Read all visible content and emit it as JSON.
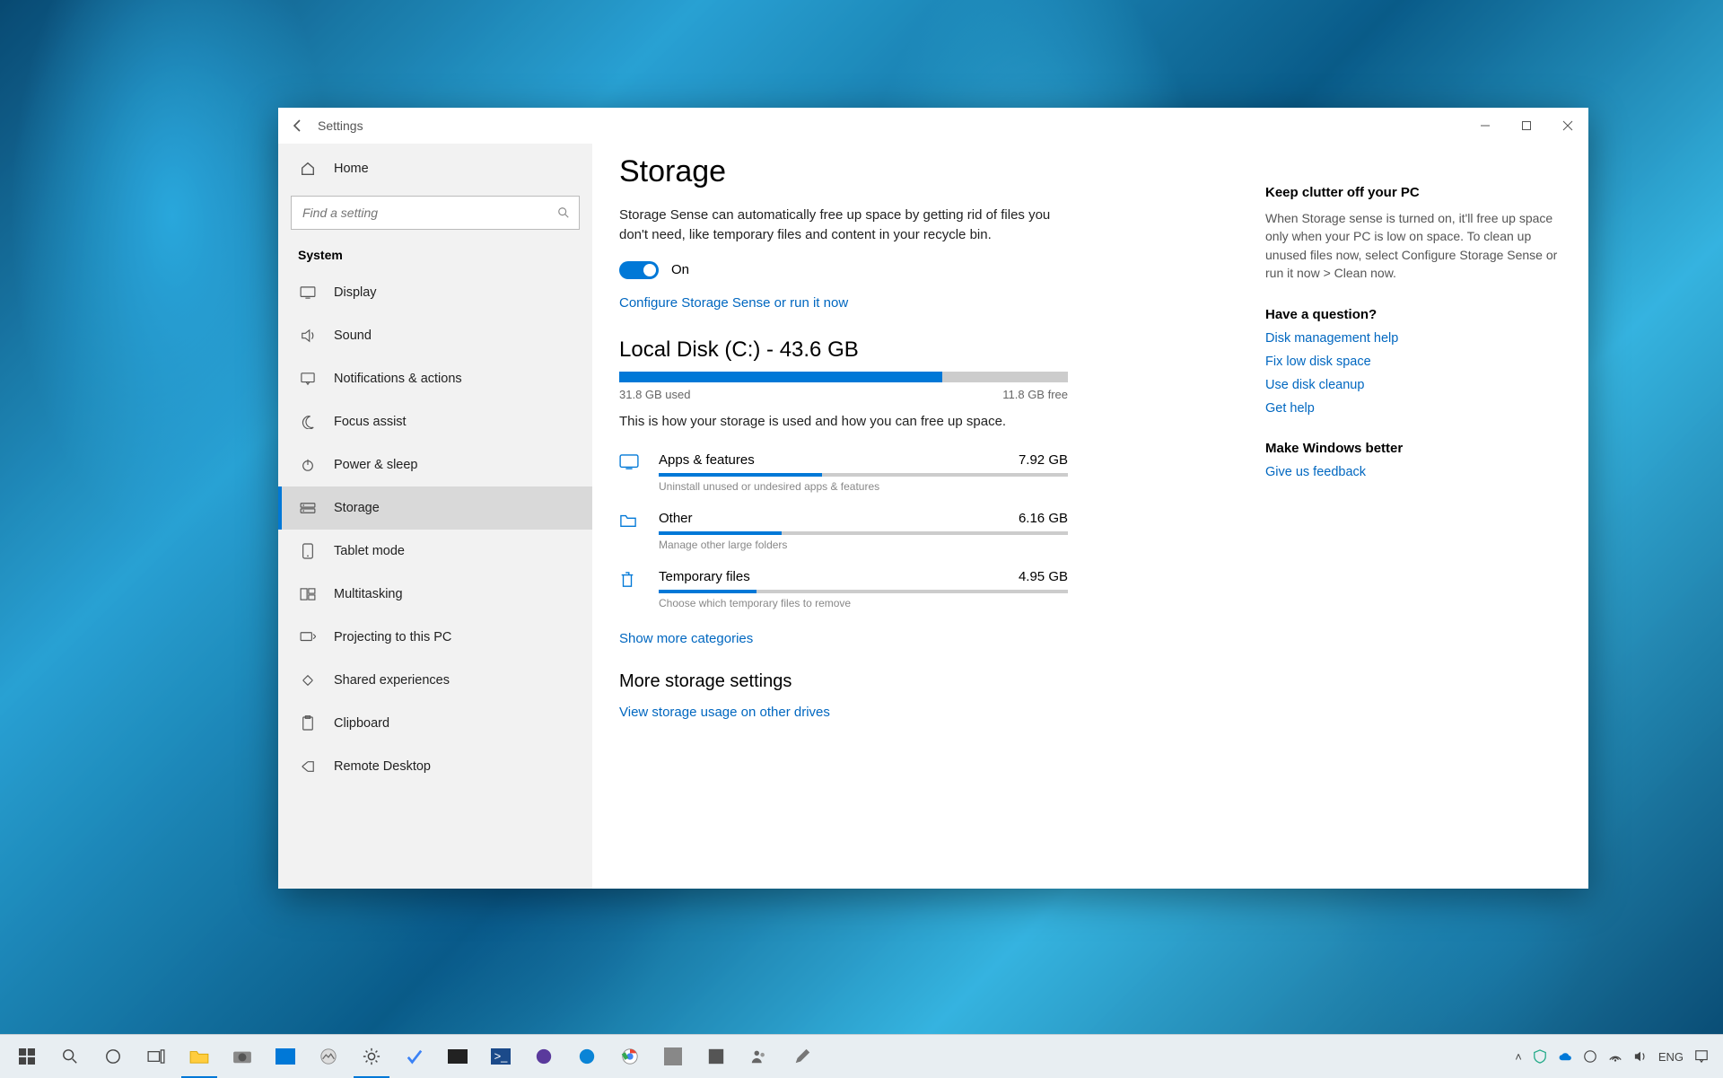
{
  "window": {
    "title": "Settings"
  },
  "sidebar": {
    "home": "Home",
    "search_placeholder": "Find a setting",
    "category": "System",
    "items": [
      {
        "label": "Display",
        "icon": "display"
      },
      {
        "label": "Sound",
        "icon": "sound"
      },
      {
        "label": "Notifications & actions",
        "icon": "notif"
      },
      {
        "label": "Focus assist",
        "icon": "moon"
      },
      {
        "label": "Power & sleep",
        "icon": "power"
      },
      {
        "label": "Storage",
        "icon": "storage",
        "active": true
      },
      {
        "label": "Tablet mode",
        "icon": "tablet"
      },
      {
        "label": "Multitasking",
        "icon": "multi"
      },
      {
        "label": "Projecting to this PC",
        "icon": "project"
      },
      {
        "label": "Shared experiences",
        "icon": "shared"
      },
      {
        "label": "Clipboard",
        "icon": "clipboard"
      },
      {
        "label": "Remote Desktop",
        "icon": "remote"
      }
    ]
  },
  "page": {
    "heading": "Storage",
    "sense_desc": "Storage Sense can automatically free up space by getting rid of files you don't need, like temporary files and content in your recycle bin.",
    "toggle_state": "On",
    "configure_link": "Configure Storage Sense or run it now",
    "disk": {
      "title": "Local Disk (C:) - 43.6 GB",
      "used": "31.8 GB used",
      "free": "11.8 GB free",
      "used_pct": 72,
      "hint": "This is how your storage is used and how you can free up space."
    },
    "categories": [
      {
        "name": "Apps & features",
        "size": "7.92 GB",
        "hint": "Uninstall unused or undesired apps & features",
        "pct": 40
      },
      {
        "name": "Other",
        "size": "6.16 GB",
        "hint": "Manage other large folders",
        "pct": 30
      },
      {
        "name": "Temporary files",
        "size": "4.95 GB",
        "hint": "Choose which temporary files to remove",
        "pct": 24
      }
    ],
    "show_more": "Show more categories",
    "more_heading": "More storage settings",
    "more_link": "View storage usage on other drives"
  },
  "rail": {
    "tip_h": "Keep clutter off your PC",
    "tip_b": "When Storage sense is turned on, it'll free up space only when your PC is low on space. To clean up unused files now, select Configure Storage Sense or run it now > Clean now.",
    "q_h": "Have a question?",
    "q_links": [
      "Disk management help",
      "Fix low disk space",
      "Use disk cleanup",
      "Get help"
    ],
    "fb_h": "Make Windows better",
    "fb_link": "Give us feedback"
  },
  "taskbar": {
    "lang": "ENG"
  }
}
